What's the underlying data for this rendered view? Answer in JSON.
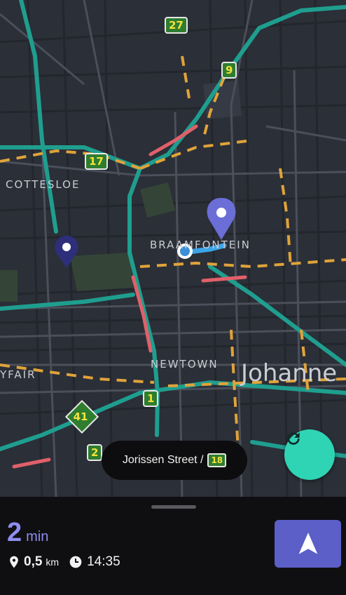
{
  "map": {
    "areas": {
      "cottesloe": "COTTESLOE",
      "braamfontein": "BRAAMFONTEIN",
      "newtown": "NEWTOWN",
      "mayfair": "YFAIR",
      "johannesburg": "Johanne"
    },
    "route_shields": [
      "27",
      "9",
      "17",
      "1",
      "2"
    ],
    "diamond_shield": "41",
    "colors": {
      "route": "#3ca5e8",
      "traffic_slow": "#e0a33a",
      "traffic_heavy": "#e0606a",
      "major_road": "#1f9e8f",
      "pin": "#6a6ed6",
      "pin_dark": "#2e2f7a"
    }
  },
  "street_pill": {
    "name": "Jorissen Street /",
    "shield": "18"
  },
  "recenter_button": {
    "icon": "refresh-icon"
  },
  "sheet": {
    "eta_value": "2",
    "eta_unit": "min",
    "distance_value": "0,5",
    "distance_unit": "km",
    "arrival_time": "14:35",
    "navigate_icon": "navigation-arrow-icon"
  }
}
